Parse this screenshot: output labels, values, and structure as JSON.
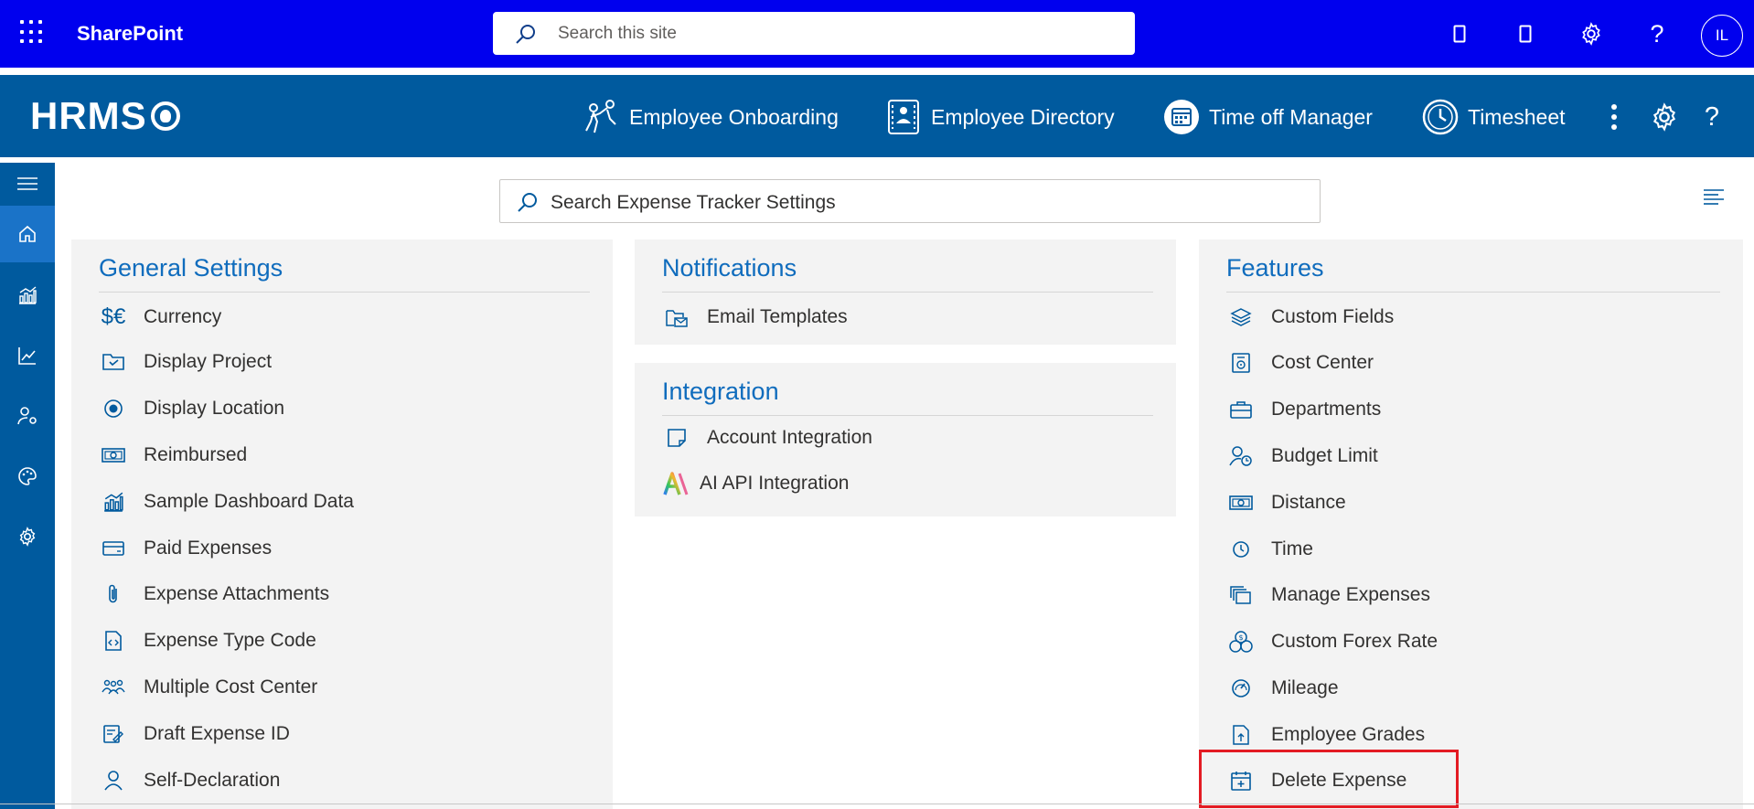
{
  "suite": {
    "app_name": "SharePoint",
    "search_placeholder": "Search this site",
    "avatar_initials": "IL"
  },
  "header": {
    "logo_text": "HRMS",
    "nav": [
      {
        "label": "Employee Onboarding",
        "icon": "onboarding-icon"
      },
      {
        "label": "Employee Directory",
        "icon": "directory-icon"
      },
      {
        "label": "Time off Manager",
        "icon": "calendar-icon"
      },
      {
        "label": "Timesheet",
        "icon": "clock-icon"
      }
    ]
  },
  "settings_search": {
    "placeholder": "Search Expense Tracker Settings"
  },
  "general": {
    "title": "General Settings",
    "items": [
      {
        "label": "Currency",
        "icon": "currency-icon"
      },
      {
        "label": "Display Project",
        "icon": "project-icon"
      },
      {
        "label": "Display Location",
        "icon": "location-icon"
      },
      {
        "label": "Reimbursed",
        "icon": "money-icon"
      },
      {
        "label": "Sample Dashboard Data",
        "icon": "chart-icon"
      },
      {
        "label": "Paid Expenses",
        "icon": "card-icon"
      },
      {
        "label": "Expense Attachments",
        "icon": "paperclip-icon"
      },
      {
        "label": "Expense Type Code",
        "icon": "code-file-icon"
      },
      {
        "label": "Multiple Cost Center",
        "icon": "people-icon"
      },
      {
        "label": "Draft Expense ID",
        "icon": "draft-icon"
      },
      {
        "label": "Self-Declaration",
        "icon": "person-icon"
      }
    ]
  },
  "notifications": {
    "title": "Notifications",
    "items": [
      {
        "label": "Email Templates",
        "icon": "email-template-icon"
      }
    ]
  },
  "integration": {
    "title": "Integration",
    "items": [
      {
        "label": "Account Integration",
        "icon": "note-icon"
      },
      {
        "label": "AI API Integration",
        "icon": "ai-icon"
      }
    ]
  },
  "features": {
    "title": "Features",
    "items": [
      {
        "label": "Custom Fields",
        "icon": "layers-icon"
      },
      {
        "label": "Cost Center",
        "icon": "cost-center-icon"
      },
      {
        "label": "Departments",
        "icon": "briefcase-icon"
      },
      {
        "label": "Budget Limit",
        "icon": "person-clock-icon"
      },
      {
        "label": "Distance",
        "icon": "money-icon"
      },
      {
        "label": "Time",
        "icon": "clock-icon"
      },
      {
        "label": "Manage Expenses",
        "icon": "stack-icon"
      },
      {
        "label": "Custom Forex Rate",
        "icon": "coins-icon"
      },
      {
        "label": "Mileage",
        "icon": "gauge-icon"
      },
      {
        "label": "Employee Grades",
        "icon": "file-upload-icon"
      },
      {
        "label": "Delete Expense",
        "icon": "calendar-add-icon"
      }
    ]
  },
  "colors": {
    "suitebar": "#0000ee",
    "appbar": "#005a9e",
    "accent": "#0f6cbd",
    "highlight": "#e31b23"
  }
}
